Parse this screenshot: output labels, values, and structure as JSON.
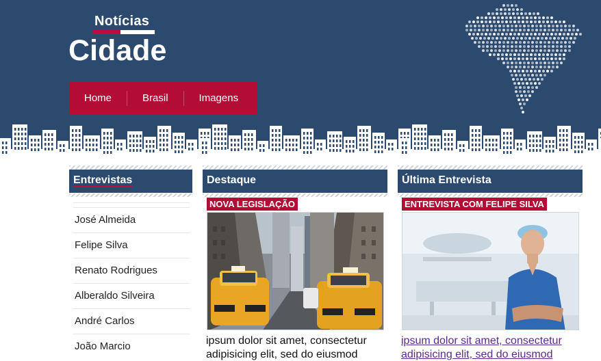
{
  "logo": {
    "small": "Notícias",
    "big": "Cidade"
  },
  "nav": {
    "items": [
      "Home",
      "Brasil",
      "Imagens"
    ]
  },
  "columns": {
    "left": {
      "title": "Entrevistas",
      "items": [
        "José Almeida",
        "Felipe Silva",
        "Renato Rodrigues",
        "Alberaldo Silveira",
        "André Carlos",
        "João Marcio"
      ]
    },
    "mid": {
      "title": "Destaque",
      "tag": "NOVA LEGISLAÇÃO",
      "excerpt": "ipsum dolor sit amet, consectetur adipisicing elit, sed do eiusmod"
    },
    "right": {
      "title": "Última Entrevista",
      "tag": "ENTREVISTA COM FELIPE SILVA",
      "excerpt": "ipsum dolor sit amet, consectetur adipisicing elit, sed do eiusmod"
    }
  },
  "colors": {
    "header": "#2c4a6e",
    "accent": "#b30c35",
    "link": "#5a2a8c"
  }
}
